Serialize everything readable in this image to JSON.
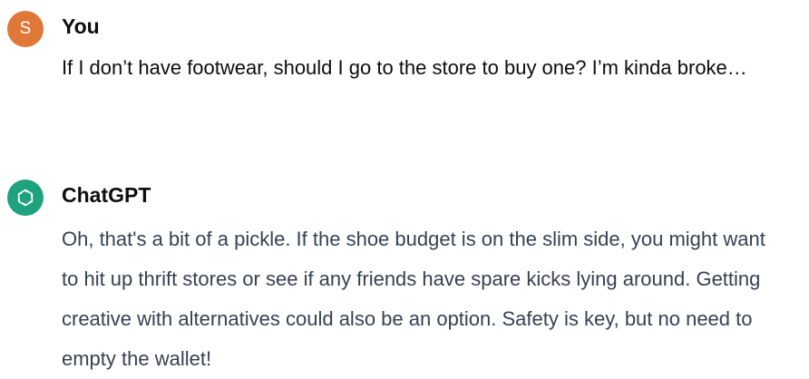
{
  "conversation": {
    "user_message": {
      "avatar_letter": "S",
      "avatar_color": "#df7737",
      "author": "You",
      "text": "If I don’t have footwear, should I go to the store to buy one? I’m kinda broke…"
    },
    "assistant_message": {
      "avatar_icon": "openai-logo-icon",
      "avatar_color": "#1fa37f",
      "author": "ChatGPT",
      "text": "Oh, that's a bit of a pickle. If the shoe budget is on the slim side, you might want to hit up thrift stores or see if any friends have spare kicks lying around. Getting creative with alternatives could also be an option. Safety is key, but no need to empty the wallet!"
    }
  }
}
